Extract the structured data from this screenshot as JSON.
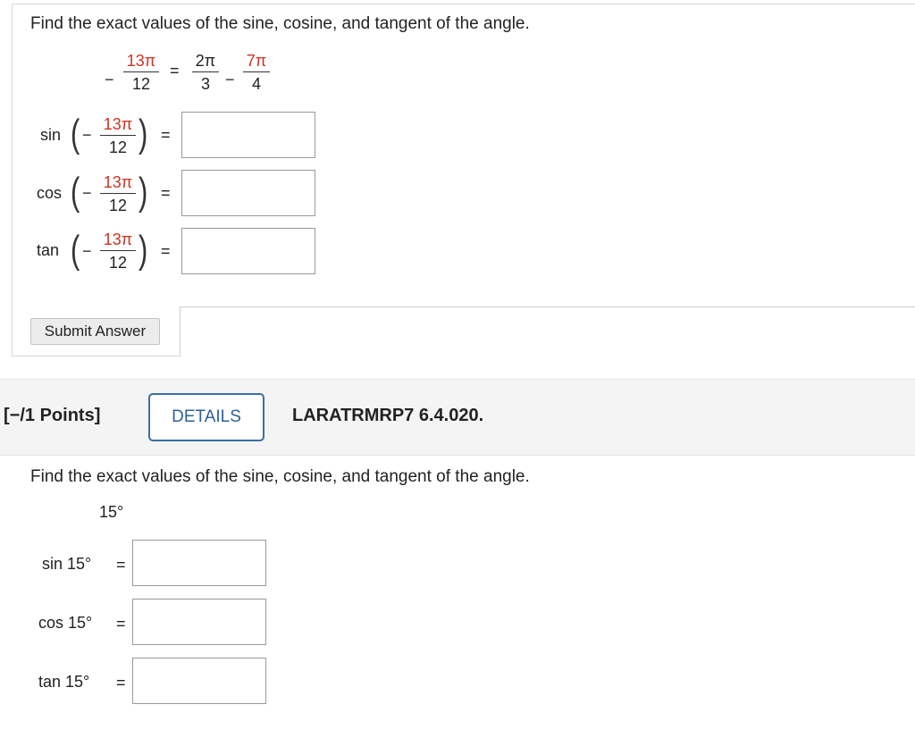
{
  "question1": {
    "prompt": "Find the exact values of the sine, cosine, and tangent of the angle.",
    "identity": {
      "lhs_sign": "−",
      "lhs_num": "13π",
      "lhs_den": "12",
      "equals": "=",
      "term1_num": "2π",
      "term1_den": "3",
      "minus": "−",
      "term2_num": "7π",
      "term2_den": "4"
    },
    "rows": [
      {
        "func": "sin",
        "sign": "−",
        "num": "13π",
        "den": "12",
        "equals": "=",
        "value": ""
      },
      {
        "func": "cos",
        "sign": "−",
        "num": "13π",
        "den": "12",
        "equals": "=",
        "value": ""
      },
      {
        "func": "tan",
        "sign": "−",
        "num": "13π",
        "den": "12",
        "equals": "=",
        "value": ""
      }
    ],
    "submit_label": "Submit Answer"
  },
  "question2": {
    "points": "[−/1 Points]",
    "details_label": "DETAILS",
    "question_id": "LARATRMRP7 6.4.020.",
    "prompt": "Find the exact values of the sine, cosine, and tangent of the angle.",
    "angle": "15°",
    "rows": [
      {
        "label": "sin 15°",
        "equals": "=",
        "value": ""
      },
      {
        "label": "cos 15°",
        "equals": "=",
        "value": ""
      },
      {
        "label": "tan 15°",
        "equals": "=",
        "value": ""
      }
    ]
  },
  "colors": {
    "accent_red": "#cc3322",
    "details_blue": "#3a6ea5"
  }
}
